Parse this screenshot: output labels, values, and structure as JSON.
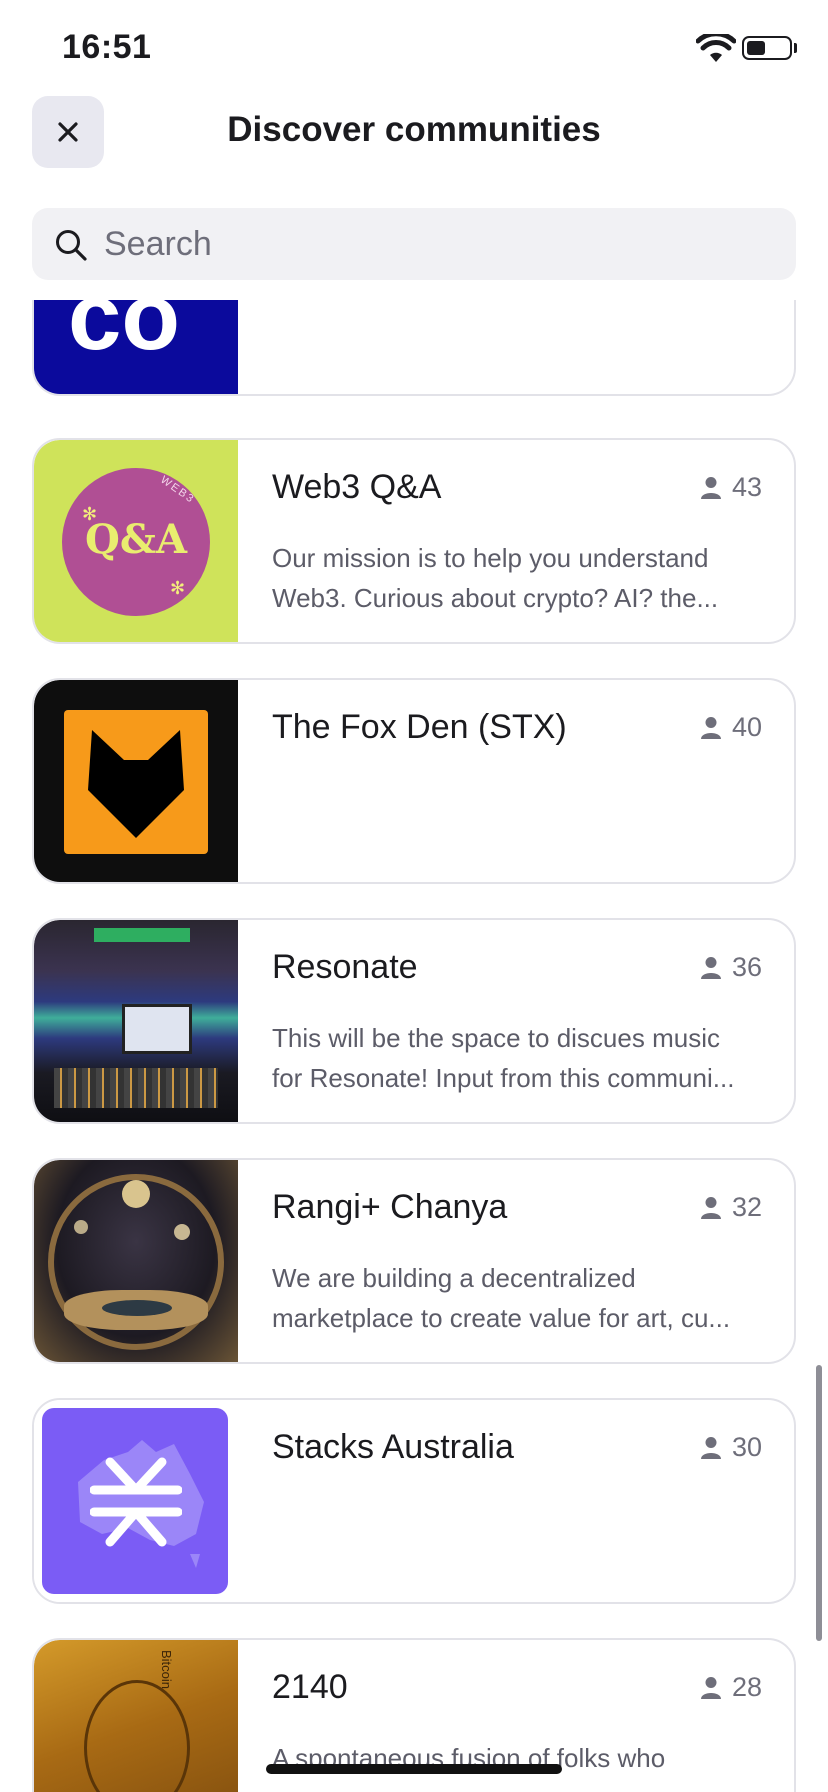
{
  "status_bar": {
    "time": "16:51"
  },
  "header": {
    "title": "Discover communities",
    "close_label": "×"
  },
  "search": {
    "placeholder": "Search",
    "value": ""
  },
  "communities": [
    {
      "name": "",
      "members": "",
      "description": [],
      "thumb_text": "co"
    },
    {
      "name": "Web3 Q&A",
      "members": "43",
      "description": [
        "Our mission is to help you understand",
        "Web3. Curious about crypto? AI? the..."
      ],
      "thumb_text": "Q&A",
      "thumb_ring": "WEB3"
    },
    {
      "name": "The Fox Den (STX)",
      "members": "40",
      "description": []
    },
    {
      "name": "Resonate",
      "members": "36",
      "description": [
        "This will be the space to discues music",
        "for Resonate! Input from this communi..."
      ]
    },
    {
      "name": "Rangi+ Chanya",
      "members": "32",
      "description": [
        "We are building a decentralized",
        "marketplace to create value for art, cu..."
      ]
    },
    {
      "name": "Stacks Australia",
      "members": "30",
      "description": []
    },
    {
      "name": "2140",
      "members": "28",
      "description": [
        "A spontaneous fusion of folks who"
      ],
      "thumb_text": "Bitcoin"
    }
  ],
  "colors": {
    "card_border": "#e2e2e8",
    "muted_text": "#6e6e7a",
    "close_bg": "#e8e8f0",
    "search_bg": "#f1f1f4"
  }
}
